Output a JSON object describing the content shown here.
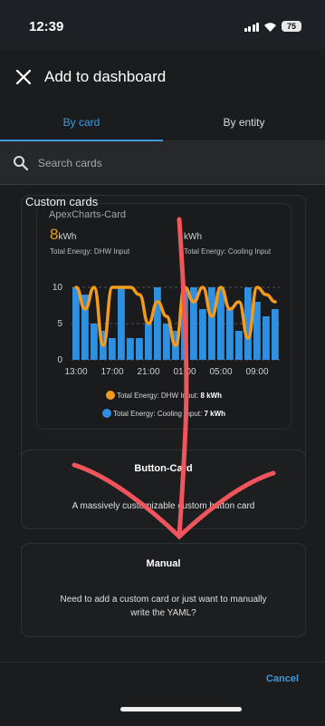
{
  "status": {
    "time": "12:39",
    "battery": "75"
  },
  "dialog": {
    "title": "Add to dashboard",
    "tabs": [
      {
        "label": "By card"
      },
      {
        "label": "By entity"
      }
    ],
    "search": {
      "placeholder": "Search cards"
    },
    "section_label": "Custom cards",
    "cancel_label": "Cancel"
  },
  "apex_card": {
    "title": "ApexCharts-Card",
    "dhw": {
      "value": "8",
      "unit": "kWh",
      "label": "Total Energy: DHW Input"
    },
    "cooling": {
      "value": "",
      "unit": "kWh",
      "label": "Total Energy: Cooling Input"
    },
    "legend": [
      {
        "name": "Total Energy: DHW Input:",
        "value": "8 kWh",
        "color": "#f29b1d"
      },
      {
        "name": "Total Energy: Cooling Input:",
        "value": "7 kWh",
        "color": "#2f8fe0"
      }
    ]
  },
  "chart_data": {
    "type": "bar",
    "categories": [
      "13:00",
      "",
      "",
      "",
      "17:00",
      "",
      "",
      "",
      "21:00",
      "",
      "",
      "",
      "01:00",
      "",
      "",
      "",
      "05:00",
      "",
      "",
      "",
      "09:00",
      "",
      ""
    ],
    "yticks": [
      "10",
      "5",
      "0"
    ],
    "ylim": [
      0,
      10
    ],
    "series": [
      {
        "name": "Total Energy: Cooling Input",
        "type": "bar",
        "color": "#2f8fe0",
        "values": [
          10,
          9,
          5,
          4,
          3,
          10,
          3,
          3,
          5,
          10,
          5,
          4,
          10,
          10,
          7,
          10,
          10,
          7,
          4,
          10,
          8,
          6,
          7
        ]
      },
      {
        "name": "Total Energy: DHW Input",
        "type": "line",
        "color": "#f29b1d",
        "values": [
          10,
          7,
          10,
          2,
          10,
          10,
          10,
          9,
          5,
          8,
          6,
          2,
          10,
          8,
          10,
          6,
          10,
          7,
          8,
          3,
          10,
          9,
          8
        ]
      }
    ]
  },
  "button_card": {
    "title": "Button-Card",
    "description": "A massively customizable custom button card"
  },
  "manual_card": {
    "title": "Manual",
    "description_line1": "Need to add a custom card or just want to manually",
    "description_line2": "write the YAML?"
  }
}
